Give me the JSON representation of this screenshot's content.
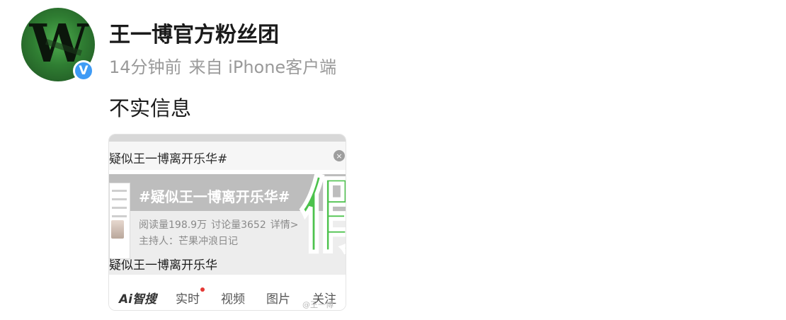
{
  "post": {
    "author": "王一博官方粉丝团",
    "time": "14分钟前",
    "source": "来自 iPhone客户端",
    "text": "不实信息",
    "avatar_letter": "W",
    "verified_mark": "V"
  },
  "screenshot_card": {
    "search_query": "疑似王一博离开乐华#",
    "clear_icon": "×",
    "topic_title": "#疑似王一博离开乐华#",
    "reads": "阅读量198.9万",
    "discussions": "讨论量3652",
    "details": "详情>",
    "host": "主持人：芒果冲浪日记",
    "stamp": "假",
    "result_title": "疑似王一博离开乐华",
    "tabs": {
      "ai": "Ai智搜",
      "live": "实时",
      "video": "视频",
      "pictures": "图片",
      "follow": "关注"
    },
    "watermark": "@王一博"
  },
  "colors": {
    "verified_blue": "#3f9bf5",
    "stamp_green": "#4cc24c",
    "meta_gray": "#9a9a9a"
  }
}
